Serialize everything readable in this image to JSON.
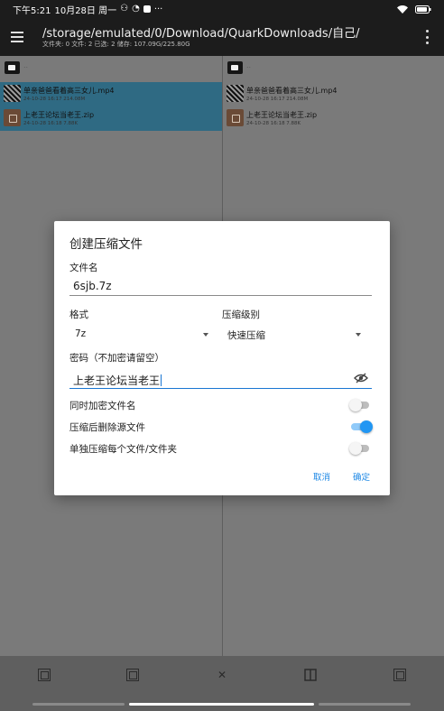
{
  "status_bar": {
    "time": "下午5:21",
    "date": "10月28日 周一",
    "extra": "···"
  },
  "app_bar": {
    "path": "/storage/emulated/0/Download/QuarkDownloads/自己/",
    "info": "文件夹: 0  文件: 2  已选: 2  储存: 107.09G/225.80G"
  },
  "left_pane": {
    "parent_label": "..",
    "files": [
      {
        "name": "单亲爸爸看着高三女儿.mp4",
        "meta": "24-10-28 16:17  214.08M",
        "type": "mp4",
        "selected": true
      },
      {
        "name": "上老王论坛当老王.zip",
        "meta": "24-10-28 16:18  7.88K",
        "type": "zip",
        "selected": true
      }
    ]
  },
  "right_pane": {
    "parent_label": "..",
    "files": [
      {
        "name": "单亲爸爸看着高三女儿.mp4",
        "meta": "24-10-28 16:17  214.08M",
        "type": "mp4"
      },
      {
        "name": "上老王论坛当老王.zip",
        "meta": "24-10-28 16:18  7.88K",
        "type": "zip"
      }
    ]
  },
  "dialog": {
    "title": "创建压缩文件",
    "filename_label": "文件名",
    "filename_value": "6sjb.7z",
    "format_label": "格式",
    "format_value": "7z",
    "level_label": "压缩级别",
    "level_value": "快速压缩",
    "password_label": "密码（不加密请留空）",
    "password_value": "上老王论坛当老王",
    "toggles": [
      {
        "label": "同时加密文件名",
        "on": false
      },
      {
        "label": "压缩后删除源文件",
        "on": true
      },
      {
        "label": "单独压缩每个文件/文件夹",
        "on": false
      }
    ],
    "cancel_label": "取消",
    "confirm_label": "确定"
  },
  "colors": {
    "accent": "#2196f3",
    "selected_row": "#2f6a83"
  }
}
